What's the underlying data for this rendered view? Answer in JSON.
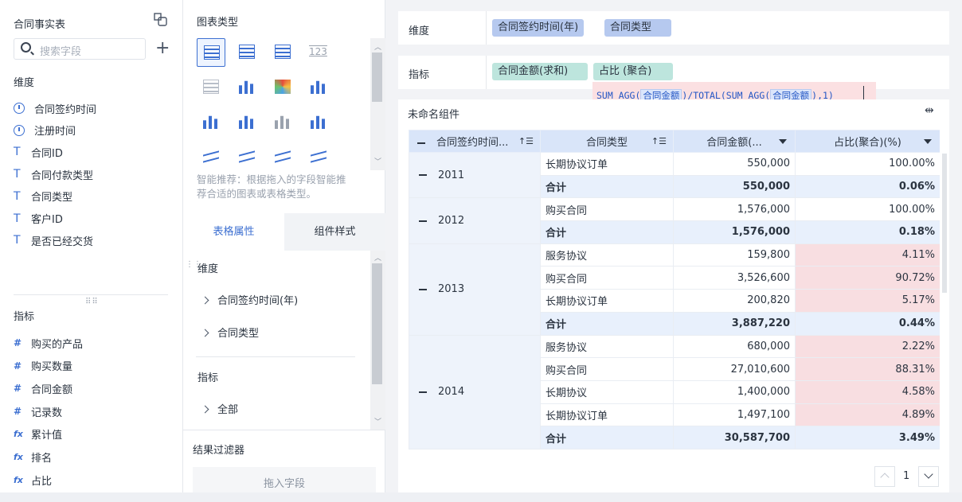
{
  "left": {
    "title": "合同事实表",
    "search_placeholder": "搜索字段",
    "dim_title": "维度",
    "dimensions": [
      {
        "icon": "clock-icon",
        "label": "合同签约时间"
      },
      {
        "icon": "clock-icon",
        "label": "注册时间"
      },
      {
        "icon": "text-type-icon",
        "label": "合同ID"
      },
      {
        "icon": "text-type-icon",
        "label": "合同付款类型"
      },
      {
        "icon": "text-type-icon",
        "label": "合同类型"
      },
      {
        "icon": "text-type-icon",
        "label": "客户ID"
      },
      {
        "icon": "text-type-icon",
        "label": "是否已经交货"
      }
    ],
    "mea_title": "指标",
    "measures": [
      {
        "icon": "hash-icon",
        "glyph": "#",
        "label": "购买的产品"
      },
      {
        "icon": "hash-icon",
        "glyph": "#",
        "label": "购买数量"
      },
      {
        "icon": "hash-icon",
        "glyph": "#",
        "label": "合同金额"
      },
      {
        "icon": "hash-calc-icon",
        "glyph": "#",
        "label": "记录数"
      },
      {
        "icon": "fx-icon",
        "glyph": "fx",
        "label": "累计值"
      },
      {
        "icon": "fx-icon",
        "glyph": "fx",
        "label": "排名"
      },
      {
        "icon": "fx-icon",
        "glyph": "fx",
        "label": "占比"
      }
    ]
  },
  "mid": {
    "chart_type_title": "图表类型",
    "recommend_text_1": "智能推荐：根据拖入的字段智能推",
    "recommend_text_2": "荐合适的图表或表格类型。",
    "tab_table_props": "表格属性",
    "tab_component_style": "组件样式",
    "props_dim_title": "维度",
    "props_dims": [
      "合同签约时间(年)",
      "合同类型"
    ],
    "props_mea_title": "指标",
    "props_mea_all": "全部",
    "filter_title": "结果过滤器",
    "drop_field": "拖入字段",
    "icon_123": "123"
  },
  "right": {
    "dim_label": "维度",
    "dim_chips": [
      "合同签约时间(年)",
      "合同类型"
    ],
    "mea_label": "指标",
    "mea_chips": [
      "合同金额(求和)",
      "占比 (聚合)"
    ],
    "formula": {
      "p1": "SUM_AGG(",
      "f1": "合同金额",
      "p2": ")/TOTAL(SUM_AGG(",
      "f2": "合同金额",
      "p3": "),1)"
    },
    "component_title": "未命名组件",
    "headers": [
      "合同签约时间...",
      "合同类型",
      "合同金额(...",
      "占比(聚合)(%)"
    ],
    "groups": [
      {
        "year": "2011",
        "rows": [
          {
            "type": "长期协议订单",
            "amount": "550,000",
            "pct": "100.00%",
            "hot": false
          },
          {
            "type": "合计",
            "amount": "550,000",
            "pct": "0.06%",
            "sub": true
          }
        ]
      },
      {
        "year": "2012",
        "rows": [
          {
            "type": "购买合同",
            "amount": "1,576,000",
            "pct": "100.00%",
            "hot": false
          },
          {
            "type": "合计",
            "amount": "1,576,000",
            "pct": "0.18%",
            "sub": true
          }
        ]
      },
      {
        "year": "2013",
        "rows": [
          {
            "type": "服务协议",
            "amount": "159,800",
            "pct": "4.11%",
            "hot": true
          },
          {
            "type": "购买合同",
            "amount": "3,526,600",
            "pct": "90.72%",
            "hot": true
          },
          {
            "type": "长期协议订单",
            "amount": "200,820",
            "pct": "5.17%",
            "hot": true
          },
          {
            "type": "合计",
            "amount": "3,887,220",
            "pct": "0.44%",
            "sub": true
          }
        ]
      },
      {
        "year": "2014",
        "rows": [
          {
            "type": "服务协议",
            "amount": "680,000",
            "pct": "2.22%",
            "hot": true
          },
          {
            "type": "购买合同",
            "amount": "27,010,600",
            "pct": "88.31%",
            "hot": true
          },
          {
            "type": "长期协议",
            "amount": "1,400,000",
            "pct": "4.58%",
            "hot": true
          },
          {
            "type": "长期协议订单",
            "amount": "1,497,100",
            "pct": "4.89%",
            "hot": true
          },
          {
            "type": "合计",
            "amount": "30,587,700",
            "pct": "3.49%",
            "sub": true
          }
        ]
      }
    ],
    "page_number": "1"
  },
  "colors": {
    "accent": "#3c6fd1",
    "dim_chip": "#b6c9ef",
    "mea_chip": "#bde5dd",
    "highlight": "#f8dee1",
    "header": "#d9e5f9"
  }
}
